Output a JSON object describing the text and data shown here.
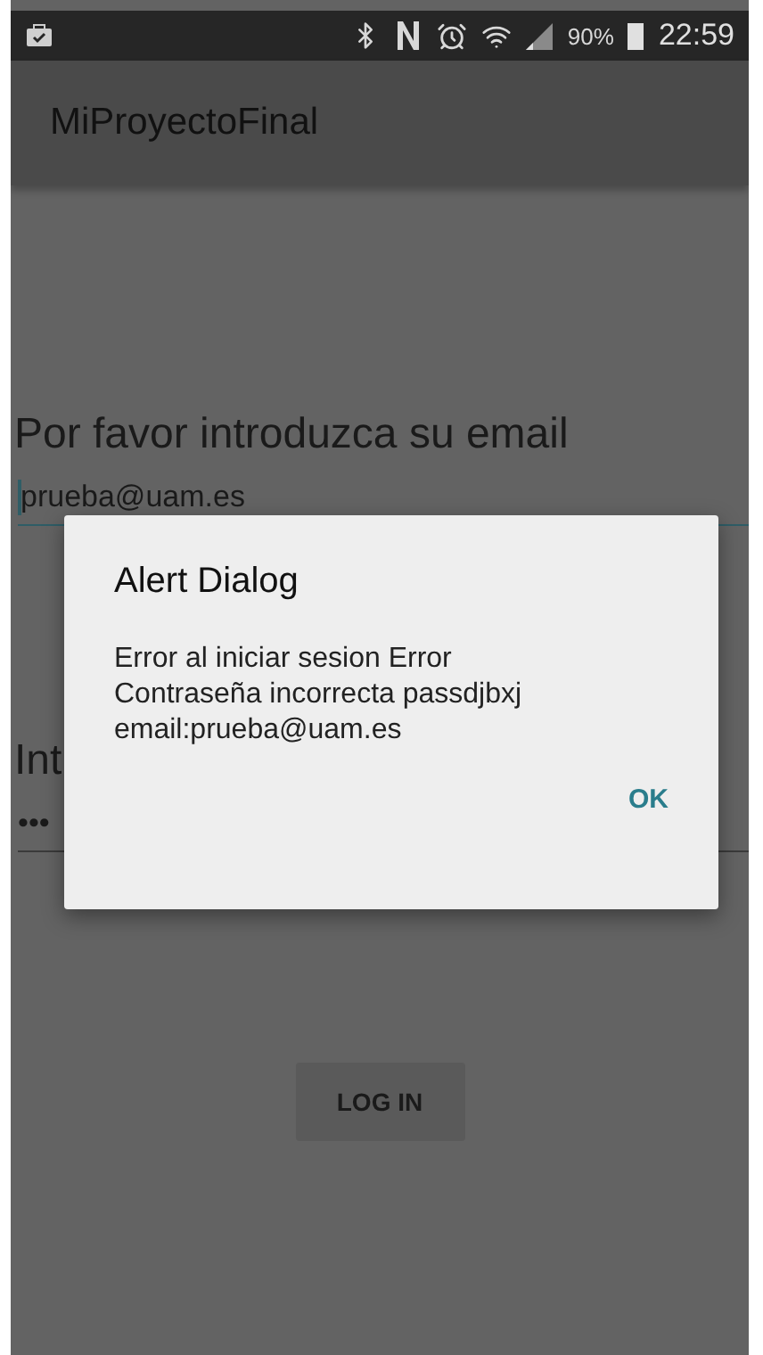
{
  "status_bar": {
    "battery": "90%",
    "time": "22:59"
  },
  "app_bar": {
    "title": "MiProyectoFinal"
  },
  "form": {
    "email_label": "Por favor introduzca su email",
    "email_value": "prueba@uam.es",
    "password_label": "Int",
    "password_value": "•••",
    "button": "LOG IN"
  },
  "dialog": {
    "title": "Alert Dialog",
    "message": "Error al iniciar sesion Error Contraseña incorrecta passdjbxj email:prueba@uam.es",
    "button": "OK"
  }
}
